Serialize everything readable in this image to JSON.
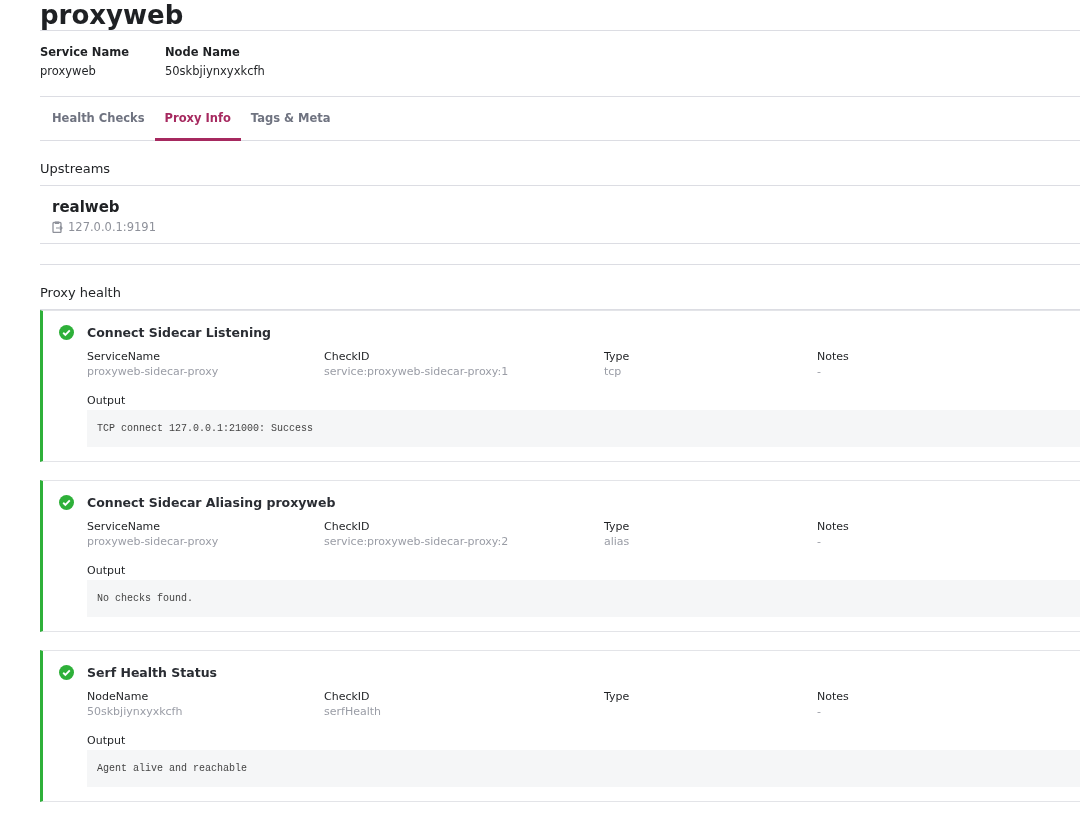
{
  "title": "proxyweb",
  "info": [
    {
      "label": "Service Name",
      "value": "proxyweb"
    },
    {
      "label": "Node Name",
      "value": "50skbjiynxyxkcfh"
    }
  ],
  "tabs": [
    {
      "label": "Health Checks",
      "selected": false
    },
    {
      "label": "Proxy Info",
      "selected": true
    },
    {
      "label": "Tags & Meta",
      "selected": false
    }
  ],
  "upstreams": {
    "heading": "Upstreams",
    "items": [
      {
        "name": "realweb",
        "address": "127.0.0.1:9191"
      }
    ]
  },
  "proxy_health": {
    "heading": "Proxy health",
    "checks": [
      {
        "passing": true,
        "name": "Connect Sidecar Listening",
        "fields": [
          {
            "label": "ServiceName",
            "value": "proxyweb-sidecar-proxy"
          },
          {
            "label": "CheckID",
            "value": "service:proxyweb-sidecar-proxy:1"
          },
          {
            "label": "Type",
            "value": "tcp"
          },
          {
            "label": "Notes",
            "value": "-"
          }
        ],
        "output_label": "Output",
        "output": "TCP connect 127.0.0.1:21000: Success"
      },
      {
        "passing": true,
        "name": "Connect Sidecar Aliasing proxyweb",
        "fields": [
          {
            "label": "ServiceName",
            "value": "proxyweb-sidecar-proxy"
          },
          {
            "label": "CheckID",
            "value": "service:proxyweb-sidecar-proxy:2"
          },
          {
            "label": "Type",
            "value": "alias"
          },
          {
            "label": "Notes",
            "value": "-"
          }
        ],
        "output_label": "Output",
        "output": "No checks found."
      },
      {
        "passing": true,
        "name": "Serf Health Status",
        "fields": [
          {
            "label": "NodeName",
            "value": "50skbjiynxyxkcfh"
          },
          {
            "label": "CheckID",
            "value": "serfHealth"
          },
          {
            "label": "Type"
          },
          {
            "label": "Notes",
            "value": "-"
          }
        ],
        "output_label": "Output",
        "output": "Agent alive and reachable"
      }
    ]
  }
}
